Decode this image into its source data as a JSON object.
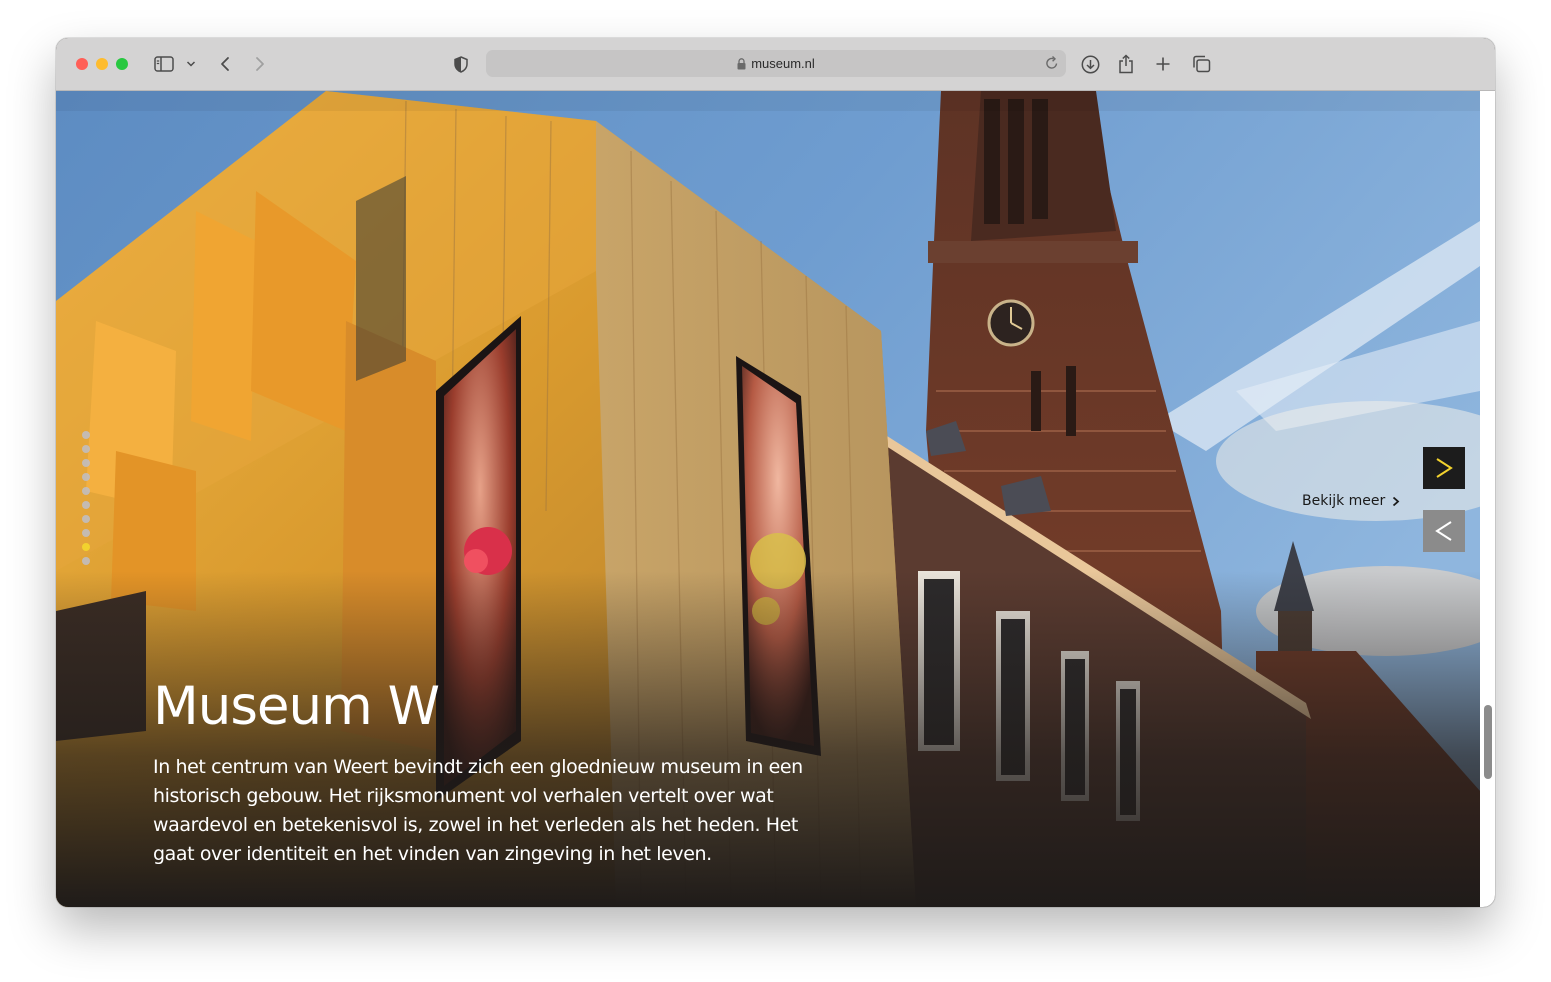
{
  "browser": {
    "url": "museum.nl",
    "traffic_lights": {
      "close": "#ff5f57",
      "minimize": "#febc2e",
      "zoom": "#28c840"
    },
    "icons": [
      "sidebar-icon",
      "chevron-down-icon",
      "back-icon",
      "forward-icon",
      "privacy-shield-icon",
      "lock-icon",
      "reload-icon",
      "download-icon",
      "share-icon",
      "new-tab-icon",
      "tab-overview-icon"
    ]
  },
  "hero": {
    "title": "Museum W",
    "description": "In het centrum van Weert bevindt zich een gloednieuw museum in een historisch gebouw. Het rijksmonument vol verhalen vertelt over wat waardevol en betekenisvol is, zowel in het verleden als het heden. Het gaat over identiteit en het vinden van zingeving in het leven.",
    "more_link": "Bekijk meer",
    "slides_count": 10,
    "active_slide": 9,
    "accent_color": "#f2d22e",
    "next_button_icon": "chevron-right-icon",
    "prev_button_icon": "chevron-left-icon"
  }
}
